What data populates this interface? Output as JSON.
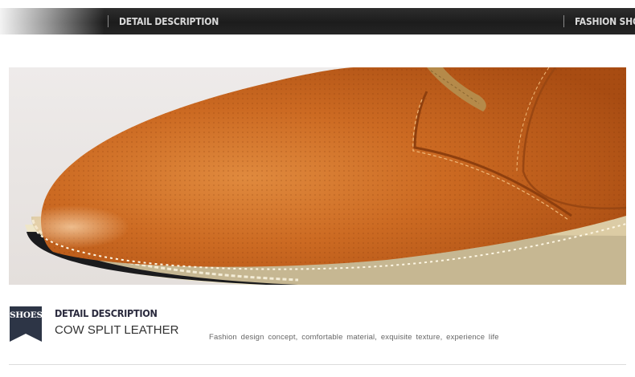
{
  "header": {
    "left_title": "DETAIL DESCRIPTION",
    "right_title": "FASHION SHOES"
  },
  "product_image": {
    "subject": "shoe-closeup-photo",
    "colors": {
      "leather": "#c8641e",
      "background": "#ece8e6",
      "lace": "#b58a4a"
    }
  },
  "section": {
    "badge": "SHOES",
    "heading": "DETAIL DESCRIPTION",
    "subheading": "COW SPLIT LEATHER",
    "tagline": "Fashion design concept, comfortable material, exquisite texture, experience life",
    "badge_color": "#2d3546"
  }
}
